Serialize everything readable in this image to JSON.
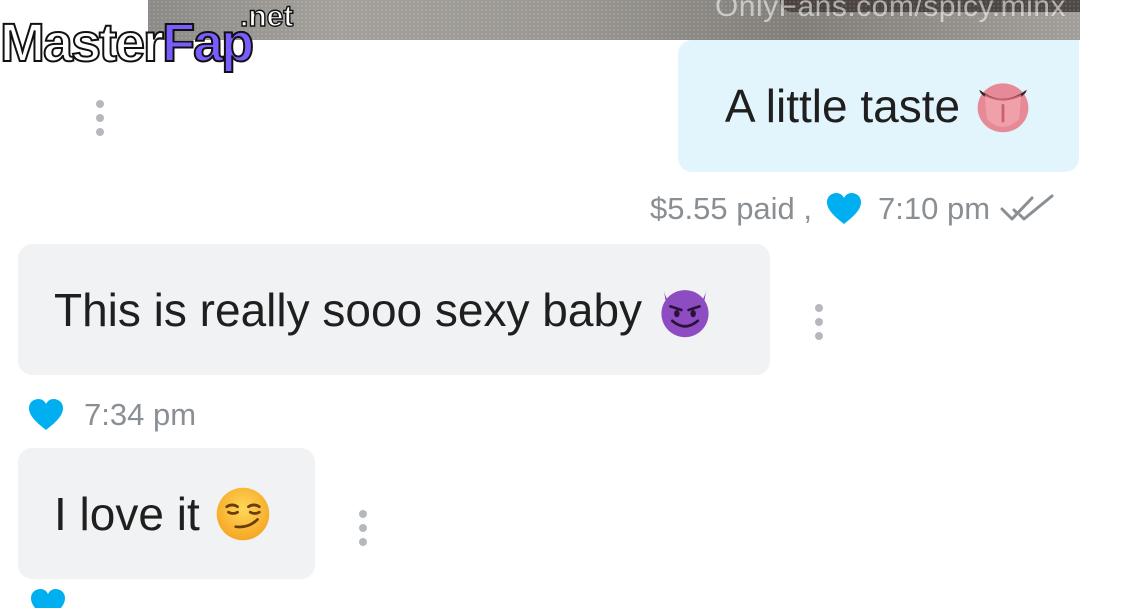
{
  "brand": {
    "logo_main": "Master",
    "logo_accent": "Fap",
    "logo_suffix": ".net"
  },
  "media": {
    "watermark": "OnlyFans.com/spicy.minx"
  },
  "messages": {
    "sent": {
      "text": "A little taste",
      "emoji": "tongue-emoji",
      "price": "$5.55 paid ,",
      "time": "7:10 pm",
      "liked": true,
      "read": true
    },
    "received_1": {
      "text": "This is really sooo sexy baby",
      "emoji": "smiling-devil-emoji",
      "time": "7:34 pm",
      "liked": true
    },
    "received_2": {
      "text": "I love it",
      "emoji": "smirk-emoji"
    }
  },
  "colors": {
    "sent_bubble": "#e3f5fc",
    "received_bubble": "#f1f2f3",
    "heart": "#00aff0",
    "meta_text": "#8a8f94",
    "kebab": "#b5b9bd"
  }
}
